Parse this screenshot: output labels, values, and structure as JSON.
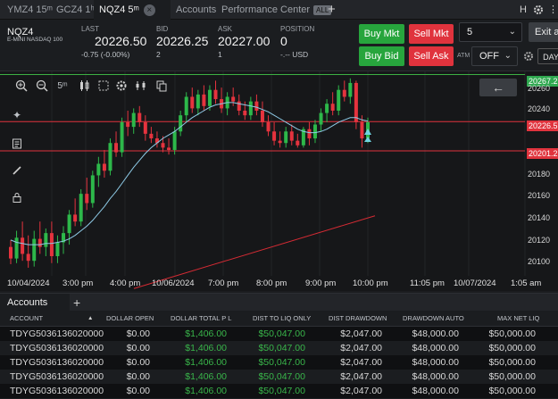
{
  "tabs": [
    {
      "label": "YMZ4 15ᵐ"
    },
    {
      "label": "GCZ4 1ʰ"
    },
    {
      "label": "NQZ4 5ᵐ",
      "active": true
    },
    {
      "label": "Accounts"
    },
    {
      "label": "Performance Center"
    }
  ],
  "tabbar": {
    "all_badge": "ALL",
    "add": "+",
    "h": "H",
    "close_icon": "×"
  },
  "quote": {
    "symbol": "NQZ4",
    "name": "E-MINI NASDAQ 100",
    "last_label": "LAST",
    "last": "20226.50",
    "change": "-0.75 (-0.00%)",
    "bid_label": "BID",
    "bid": "20226.25",
    "bid_size": "2",
    "ask_label": "ASK",
    "ask": "20227.00",
    "ask_size": "1",
    "position_label": "POSITION",
    "position": "0",
    "position_sub": "-.-- USD"
  },
  "order": {
    "buy_mkt": "Buy Mkt",
    "sell_mkt": "Sell Mkt",
    "buy_bid": "Buy Bid",
    "sell_ask": "Sell Ask",
    "qty": "5",
    "exit_all": "Exit a",
    "atm_label": "ATM",
    "atm_value": "OFF",
    "tif": "DAY"
  },
  "chart_toolbar": {
    "timeframe": "5ᵐ",
    "back": "←"
  },
  "chart_data": {
    "type": "candlestick",
    "x_ticks": [
      "10/04/2024",
      "3:00 pm",
      "4:00 pm",
      "10/06/2024",
      "7:00 pm",
      "8:00 pm",
      "9:00 pm",
      "10:00 pm",
      "11:05 pm",
      "10/07/2024",
      "1:05 am"
    ],
    "y_ticks": [
      20260,
      20240,
      20220,
      20200,
      20180,
      20160,
      20140,
      20120,
      20100
    ],
    "ylim": [
      20093,
      20270
    ],
    "price_tags": [
      {
        "label": "20267.2",
        "value": 20267.25,
        "color": "#2fa84f"
      },
      {
        "label": "20226.5",
        "value": 20226.5,
        "color": "#e0333d"
      },
      {
        "label": "20201.2",
        "value": 20201.25,
        "color": "#e0333d"
      }
    ],
    "horizontal_lines": [
      {
        "value": 20267.25,
        "color": "#3cb043"
      },
      {
        "value": 20226.5,
        "color": "#e0333d"
      },
      {
        "value": 20201.25,
        "color": "#e0333d"
      }
    ],
    "candles": [
      {
        "o": 20118,
        "h": 20124,
        "l": 20103,
        "c": 20108
      },
      {
        "o": 20108,
        "h": 20132,
        "l": 20104,
        "c": 20126
      },
      {
        "o": 20126,
        "h": 20140,
        "l": 20106,
        "c": 20112
      },
      {
        "o": 20112,
        "h": 20128,
        "l": 20100,
        "c": 20106
      },
      {
        "o": 20106,
        "h": 20132,
        "l": 20101,
        "c": 20125
      },
      {
        "o": 20125,
        "h": 20140,
        "l": 20112,
        "c": 20118
      },
      {
        "o": 20118,
        "h": 20134,
        "l": 20110,
        "c": 20130
      },
      {
        "o": 20130,
        "h": 20140,
        "l": 20104,
        "c": 20110
      },
      {
        "o": 20110,
        "h": 20128,
        "l": 20104,
        "c": 20122
      },
      {
        "o": 20122,
        "h": 20136,
        "l": 20112,
        "c": 20130
      },
      {
        "o": 20130,
        "h": 20150,
        "l": 20120,
        "c": 20146
      },
      {
        "o": 20146,
        "h": 20160,
        "l": 20136,
        "c": 20140
      },
      {
        "o": 20140,
        "h": 20168,
        "l": 20136,
        "c": 20164
      },
      {
        "o": 20164,
        "h": 20178,
        "l": 20150,
        "c": 20156
      },
      {
        "o": 20156,
        "h": 20184,
        "l": 20152,
        "c": 20180
      },
      {
        "o": 20180,
        "h": 20196,
        "l": 20170,
        "c": 20190
      },
      {
        "o": 20190,
        "h": 20202,
        "l": 20178,
        "c": 20184
      },
      {
        "o": 20184,
        "h": 20212,
        "l": 20180,
        "c": 20208
      },
      {
        "o": 20208,
        "h": 20218,
        "l": 20196,
        "c": 20200
      },
      {
        "o": 20200,
        "h": 20230,
        "l": 20196,
        "c": 20226
      },
      {
        "o": 20226,
        "h": 20236,
        "l": 20214,
        "c": 20222
      },
      {
        "o": 20222,
        "h": 20238,
        "l": 20216,
        "c": 20234
      },
      {
        "o": 20234,
        "h": 20240,
        "l": 20222,
        "c": 20226
      },
      {
        "o": 20226,
        "h": 20232,
        "l": 20210,
        "c": 20216
      },
      {
        "o": 20216,
        "h": 20222,
        "l": 20208,
        "c": 20212
      },
      {
        "o": 20212,
        "h": 20218,
        "l": 20204,
        "c": 20208
      },
      {
        "o": 20208,
        "h": 20214,
        "l": 20200,
        "c": 20204
      },
      {
        "o": 20204,
        "h": 20212,
        "l": 20198,
        "c": 20202
      },
      {
        "o": 20202,
        "h": 20222,
        "l": 20198,
        "c": 20218
      },
      {
        "o": 20218,
        "h": 20236,
        "l": 20214,
        "c": 20232
      },
      {
        "o": 20232,
        "h": 20252,
        "l": 20226,
        "c": 20248
      },
      {
        "o": 20248,
        "h": 20256,
        "l": 20234,
        "c": 20238
      },
      {
        "o": 20238,
        "h": 20254,
        "l": 20232,
        "c": 20250
      },
      {
        "o": 20250,
        "h": 20258,
        "l": 20236,
        "c": 20240
      },
      {
        "o": 20240,
        "h": 20258,
        "l": 20236,
        "c": 20254
      },
      {
        "o": 20254,
        "h": 20262,
        "l": 20242,
        "c": 20246
      },
      {
        "o": 20246,
        "h": 20256,
        "l": 20234,
        "c": 20238
      },
      {
        "o": 20238,
        "h": 20252,
        "l": 20232,
        "c": 20248
      },
      {
        "o": 20248,
        "h": 20256,
        "l": 20240,
        "c": 20244
      },
      {
        "o": 20244,
        "h": 20250,
        "l": 20232,
        "c": 20236
      },
      {
        "o": 20236,
        "h": 20244,
        "l": 20228,
        "c": 20232
      },
      {
        "o": 20232,
        "h": 20248,
        "l": 20228,
        "c": 20244
      },
      {
        "o": 20244,
        "h": 20250,
        "l": 20232,
        "c": 20236
      },
      {
        "o": 20236,
        "h": 20244,
        "l": 20222,
        "c": 20226
      },
      {
        "o": 20226,
        "h": 20232,
        "l": 20214,
        "c": 20218
      },
      {
        "o": 20218,
        "h": 20226,
        "l": 20206,
        "c": 20210
      },
      {
        "o": 20210,
        "h": 20218,
        "l": 20204,
        "c": 20208
      },
      {
        "o": 20208,
        "h": 20222,
        "l": 20204,
        "c": 20218
      },
      {
        "o": 20218,
        "h": 20224,
        "l": 20206,
        "c": 20210
      },
      {
        "o": 20210,
        "h": 20216,
        "l": 20204,
        "c": 20206
      },
      {
        "o": 20206,
        "h": 20222,
        "l": 20204,
        "c": 20220
      },
      {
        "o": 20220,
        "h": 20226,
        "l": 20206,
        "c": 20212
      },
      {
        "o": 20212,
        "h": 20228,
        "l": 20208,
        "c": 20224
      },
      {
        "o": 20224,
        "h": 20238,
        "l": 20218,
        "c": 20234
      },
      {
        "o": 20234,
        "h": 20246,
        "l": 20226,
        "c": 20242
      },
      {
        "o": 20242,
        "h": 20252,
        "l": 20232,
        "c": 20236
      },
      {
        "o": 20236,
        "h": 20258,
        "l": 20232,
        "c": 20254
      },
      {
        "o": 20254,
        "h": 20262,
        "l": 20244,
        "c": 20248
      },
      {
        "o": 20248,
        "h": 20264,
        "l": 20242,
        "c": 20260
      },
      {
        "o": 20260,
        "h": 20262,
        "l": 20220,
        "c": 20226
      },
      {
        "o": 20226,
        "h": 20232,
        "l": 20204,
        "c": 20212
      },
      {
        "o": 20212,
        "h": 20230,
        "l": 20208,
        "c": 20226
      }
    ],
    "ma_cyan": [
      20124,
      20122,
      20121,
      20120,
      20120,
      20120,
      20121,
      20121,
      20122,
      20123,
      20125,
      20128,
      20132,
      20136,
      20141,
      20147,
      20153,
      20160,
      20166,
      20173,
      20180,
      20187,
      20193,
      20199,
      20204,
      20208,
      20212,
      20215,
      20218,
      20222,
      20226,
      20230,
      20233,
      20236,
      20239,
      20241,
      20242,
      20243,
      20243,
      20242,
      20241,
      20240,
      20239,
      20237,
      20235,
      20232,
      20229,
      20226,
      20223,
      20220,
      20218,
      20217,
      20217,
      20218,
      20220,
      20223,
      20226,
      20228,
      20230,
      20230,
      20228,
      20227
    ],
    "trend_red": {
      "from": 20082,
      "to": 20145
    }
  },
  "accounts": {
    "tab_label": "Accounts",
    "add": "+",
    "columns": [
      "ACCOUNT",
      "DOLLAR OPEN",
      "DOLLAR TOTAL P L",
      "DIST TO LIQ ONLY",
      "DIST DRAWDOWN",
      "DRAWDOWN AUTO",
      "MAX NET LIQ"
    ],
    "sort_icon": "▲",
    "rows": [
      {
        "account": "TDYG5036136020000",
        "open": "$0.00",
        "total": "$1,406.00",
        "liq": "$50,047.00",
        "dd": "$2,047.00",
        "auto": "$48,000.00",
        "max": "$50,000.00"
      },
      {
        "account": "TDYG5036136020000",
        "open": "$0.00",
        "total": "$1,406.00",
        "liq": "$50,047.00",
        "dd": "$2,047.00",
        "auto": "$48,000.00",
        "max": "$50,000.00"
      },
      {
        "account": "TDYG5036136020000",
        "open": "$0.00",
        "total": "$1,406.00",
        "liq": "$50,047.00",
        "dd": "$2,047.00",
        "auto": "$48,000.00",
        "max": "$50,000.00"
      },
      {
        "account": "TDYG5036136020000",
        "open": "$0.00",
        "total": "$1,406.00",
        "liq": "$50,047.00",
        "dd": "$2,047.00",
        "auto": "$48,000.00",
        "max": "$50,000.00"
      },
      {
        "account": "TDYG5036136020000",
        "open": "$0.00",
        "total": "$1,406.00",
        "liq": "$50,047.00",
        "dd": "$2,047.00",
        "auto": "$48,000.00",
        "max": "$50,000.00"
      }
    ]
  }
}
